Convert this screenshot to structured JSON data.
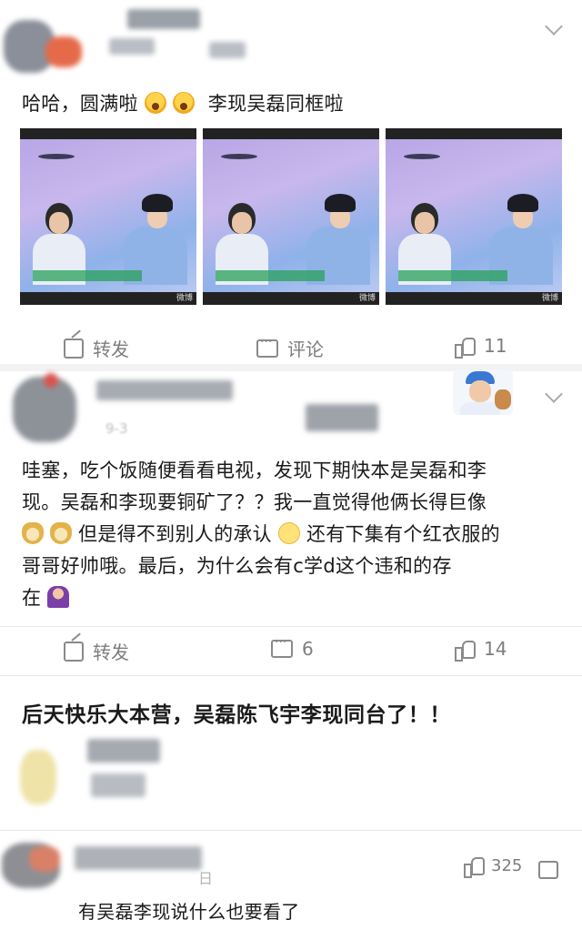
{
  "post1": {
    "text_before": "哈哈，圆满啦",
    "text_after": "李现吴磊同框啦",
    "emojis": [
      "face-screaming-icon",
      "face-screaming-icon"
    ],
    "images": [
      {
        "watermark": "微博"
      },
      {
        "watermark": "微博"
      },
      {
        "watermark": "微博"
      }
    ],
    "actions": {
      "repost": "转发",
      "comment": "评论",
      "likes": "11"
    }
  },
  "post2": {
    "meta_visible": "9-3",
    "text_line1": "哇塞，吃个饭随便看看电视，发现下期快本是吴磊和李",
    "text_line2": "现。吴磊和李现要铜矿了？？我一直觉得他俩长得巨像",
    "text_line3_a": "但是得不到别人的承认",
    "text_line3_b": "还有下集有个红衣服的",
    "text_line4": "哥哥好帅哦。最后，为什么会有c学d这个违和的存",
    "text_line5": "在",
    "actions": {
      "repost": "转发",
      "comments": "6",
      "likes": "14"
    }
  },
  "post3": {
    "text": "后天快乐大本营，吴磊陈飞宇李现同台了！！"
  },
  "comment": {
    "date_fragment": "日",
    "likes": "325",
    "text": "有吴磊李现说什么也要看了"
  },
  "colors": {
    "text": "#1a1a1a",
    "muted": "#7d7d7d",
    "divider": "#e8e8e8"
  }
}
